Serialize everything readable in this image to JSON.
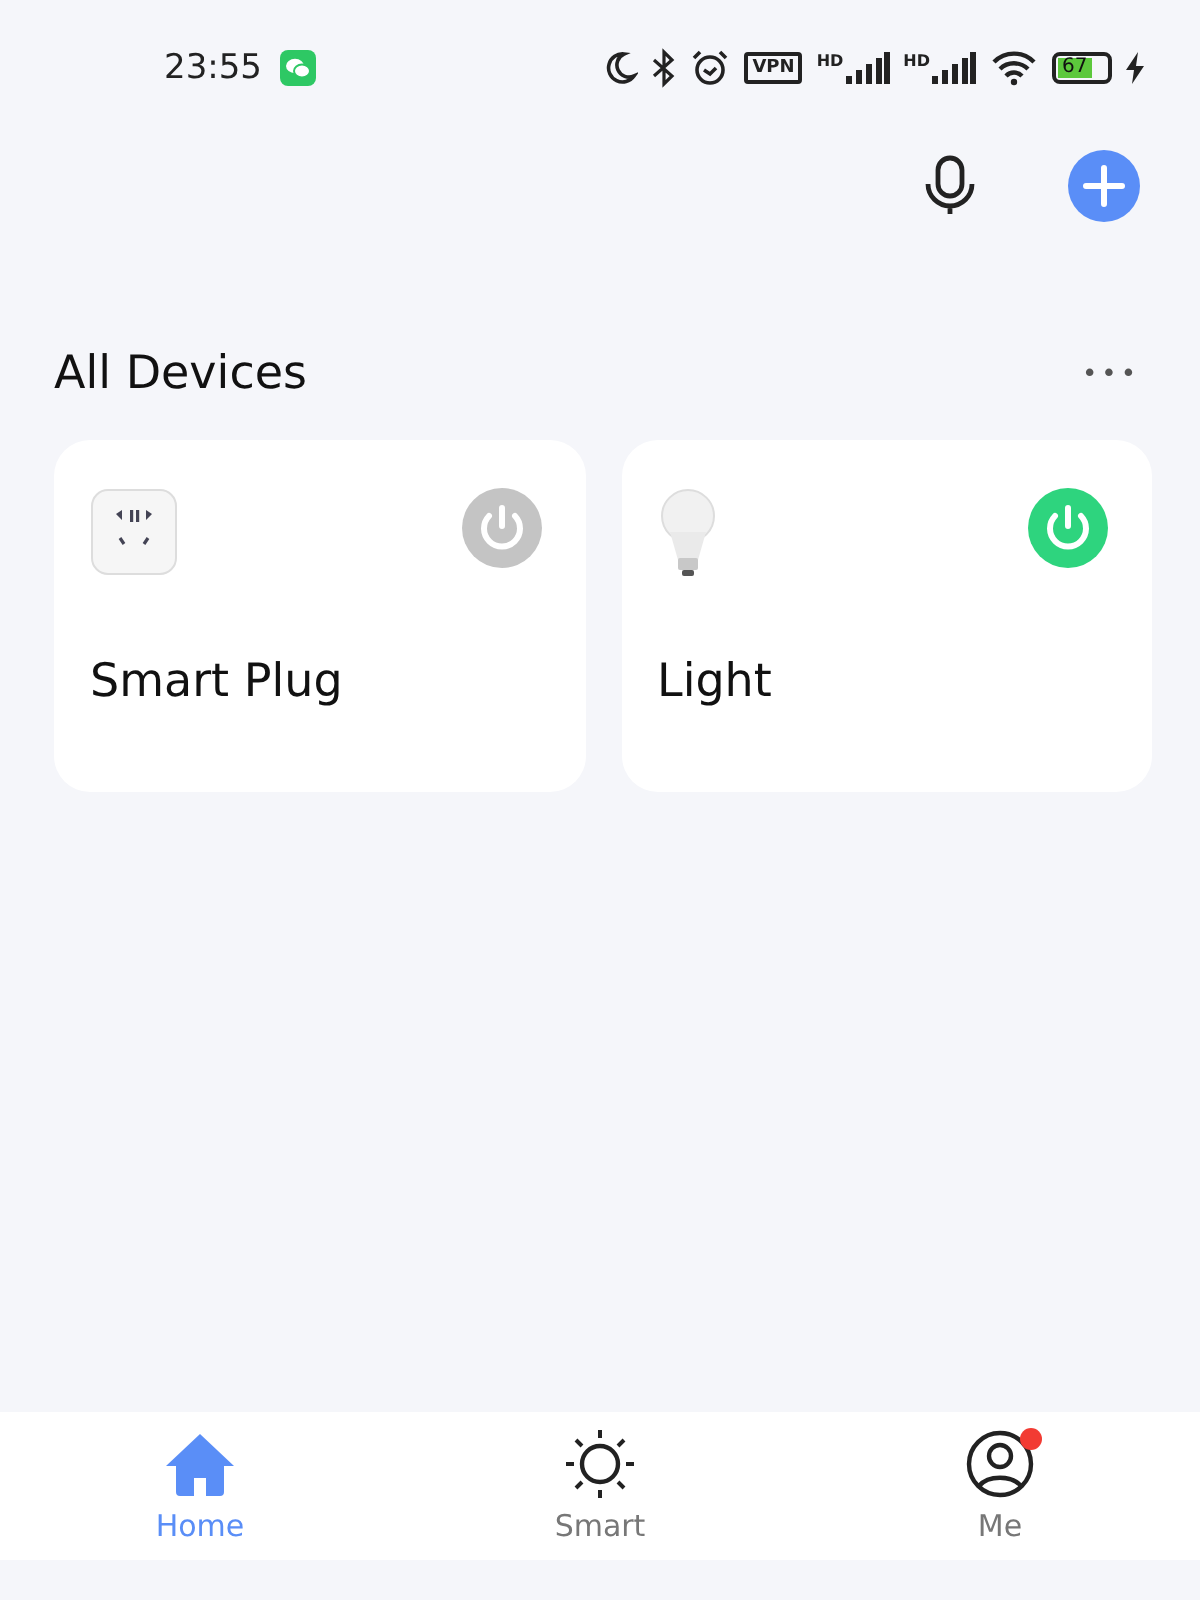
{
  "status_bar": {
    "time": "23:55",
    "vpn": "VPN",
    "sim_1": "HD",
    "sim_2": "HD",
    "battery": "67"
  },
  "section": {
    "title": "All Devices",
    "more": "•••"
  },
  "devices": [
    {
      "name": "Smart Plug",
      "kind": "plug",
      "on": false
    },
    {
      "name": "Light",
      "kind": "bulb",
      "on": true
    }
  ],
  "tabs": [
    {
      "label": "Home",
      "kind": "home",
      "selected": true,
      "notification": false
    },
    {
      "label": "Smart",
      "kind": "smart",
      "selected": false,
      "notification": false
    },
    {
      "label": "Me",
      "kind": "me",
      "selected": false,
      "notification": true
    }
  ]
}
